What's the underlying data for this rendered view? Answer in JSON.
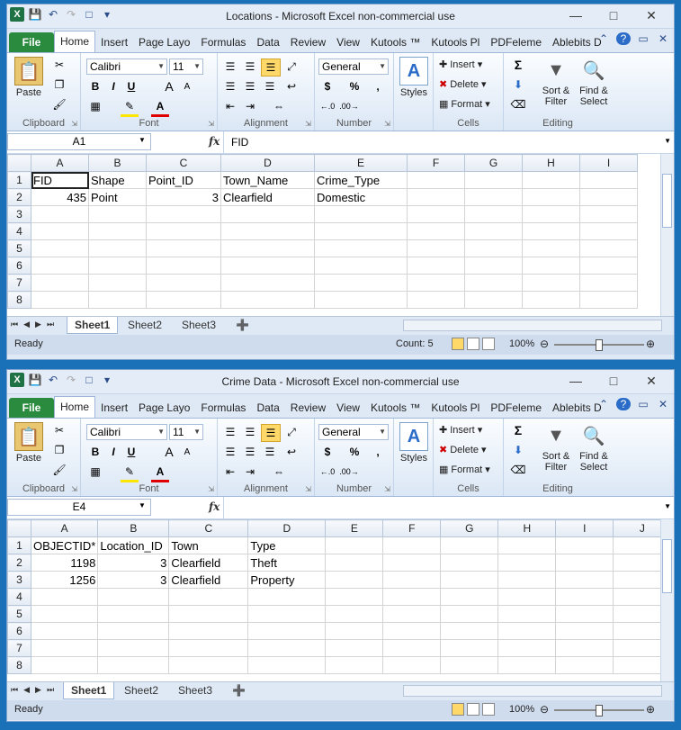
{
  "windows": [
    {
      "title": "Locations  -  Microsoft Excel non-commercial use",
      "tabs": [
        "File",
        "Home",
        "Insert",
        "Page Layo",
        "Formulas",
        "Data",
        "Review",
        "View",
        "Kutools ™",
        "Kutools Pl",
        "PDFeleme",
        "Ablebits D"
      ],
      "active_tab": "Home",
      "font_name": "Calibri",
      "font_size": "11",
      "number_format": "General",
      "ribbon": {
        "clipboard_label": "Clipboard",
        "font_label": "Font",
        "alignment_label": "Alignment",
        "number_label": "Number",
        "cells_label": "Cells",
        "editing_label": "Editing",
        "paste": "Paste",
        "styles": "Styles",
        "insert": "Insert",
        "delete": "Delete",
        "format": "Format",
        "sort_filter_1": "Sort &",
        "sort_filter_2": "Filter",
        "find_select_1": "Find &",
        "find_select_2": "Select",
        "bold": "B",
        "italic": "I",
        "underline": "U",
        "grow_font": "A",
        "shrink_font": "A",
        "font_color": "A",
        "currency": "$",
        "percent": "%",
        "comma": ",",
        "sigma": "Σ"
      },
      "name_box": "A1",
      "fx": "fx",
      "formula": "FID",
      "columns": [
        "A",
        "B",
        "C",
        "D",
        "E",
        "F",
        "G",
        "H",
        "I"
      ],
      "rows": [
        [
          "FID",
          "Shape",
          "Point_ID",
          "Town_Name",
          "Crime_Type",
          "",
          "",
          "",
          ""
        ],
        [
          "435",
          "Point",
          "3",
          "Clearfield",
          "Domestic",
          "",
          "",
          "",
          ""
        ],
        [
          "",
          "",
          "",
          "",
          "",
          "",
          "",
          "",
          ""
        ],
        [
          "",
          "",
          "",
          "",
          "",
          "",
          "",
          "",
          ""
        ],
        [
          "",
          "",
          "",
          "",
          "",
          "",
          "",
          "",
          ""
        ],
        [
          "",
          "",
          "",
          "",
          "",
          "",
          "",
          "",
          ""
        ],
        [
          "",
          "",
          "",
          "",
          "",
          "",
          "",
          "",
          ""
        ],
        [
          "",
          "",
          "",
          "",
          "",
          "",
          "",
          "",
          ""
        ]
      ],
      "row_numbers": [
        "1",
        "2",
        "3",
        "4",
        "5",
        "6",
        "7",
        "8"
      ],
      "sheets": [
        "Sheet1",
        "Sheet2",
        "Sheet3"
      ],
      "status": "Ready",
      "count": "Count: 5",
      "zoom": "100%"
    },
    {
      "title": "Crime Data  -  Microsoft Excel non-commercial use",
      "tabs": [
        "File",
        "Home",
        "Insert",
        "Page Layo",
        "Formulas",
        "Data",
        "Review",
        "View",
        "Kutools ™",
        "Kutools Pl",
        "PDFeleme",
        "Ablebits D"
      ],
      "active_tab": "Home",
      "font_name": "Calibri",
      "font_size": "11",
      "number_format": "General",
      "ribbon": {
        "clipboard_label": "Clipboard",
        "font_label": "Font",
        "alignment_label": "Alignment",
        "number_label": "Number",
        "cells_label": "Cells",
        "editing_label": "Editing",
        "paste": "Paste",
        "styles": "Styles",
        "insert": "Insert",
        "delete": "Delete",
        "format": "Format",
        "sort_filter_1": "Sort &",
        "sort_filter_2": "Filter",
        "find_select_1": "Find &",
        "find_select_2": "Select",
        "bold": "B",
        "italic": "I",
        "underline": "U",
        "grow_font": "A",
        "shrink_font": "A",
        "font_color": "A",
        "currency": "$",
        "percent": "%",
        "comma": ",",
        "sigma": "Σ"
      },
      "name_box": "E4",
      "fx": "fx",
      "formula": "",
      "columns": [
        "A",
        "B",
        "C",
        "D",
        "E",
        "F",
        "G",
        "H",
        "I",
        "J"
      ],
      "rows": [
        [
          "OBJECTID*",
          "Location_ID",
          "Town",
          "Type",
          "",
          "",
          "",
          "",
          "",
          ""
        ],
        [
          "1198",
          "3",
          "Clearfield",
          "Theft",
          "",
          "",
          "",
          "",
          "",
          ""
        ],
        [
          "1256",
          "3",
          "Clearfield",
          "Property",
          "",
          "",
          "",
          "",
          "",
          ""
        ],
        [
          "",
          "",
          "",
          "",
          "",
          "",
          "",
          "",
          "",
          ""
        ],
        [
          "",
          "",
          "",
          "",
          "",
          "",
          "",
          "",
          "",
          ""
        ],
        [
          "",
          "",
          "",
          "",
          "",
          "",
          "",
          "",
          "",
          ""
        ],
        [
          "",
          "",
          "",
          "",
          "",
          "",
          "",
          "",
          "",
          ""
        ],
        [
          "",
          "",
          "",
          "",
          "",
          "",
          "",
          "",
          "",
          ""
        ]
      ],
      "row_numbers": [
        "1",
        "2",
        "3",
        "4",
        "5",
        "6",
        "7",
        "8"
      ],
      "sheets": [
        "Sheet1",
        "Sheet2",
        "Sheet3"
      ],
      "status": "Ready",
      "count": "",
      "zoom": "100%"
    }
  ]
}
